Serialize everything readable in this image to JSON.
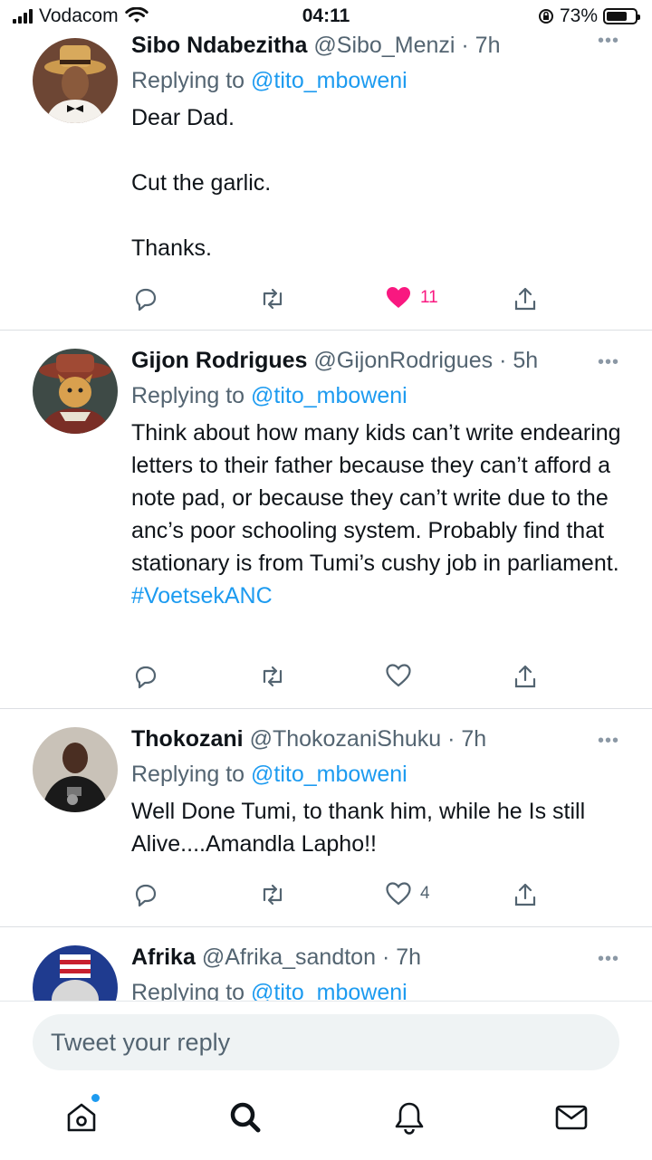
{
  "status_bar": {
    "carrier": "Vodacom",
    "time": "04:11",
    "battery": "73%",
    "battery_level": 0.73
  },
  "tweets": [
    {
      "name": "Sibo Ndabezitha",
      "handle": "@Sibo_Menzi",
      "time": "· 7h",
      "replying_prefix": "Replying to ",
      "replying_handle": "@tito_mboweni",
      "text": "Dear Dad.\n\nCut the garlic.\n\nThanks.",
      "hashtag": "",
      "likes": "11",
      "liked": true
    },
    {
      "name": "Gijon Rodrigues",
      "handle": "@GijonRodrigues",
      "time": "· 5h",
      "replying_prefix": "Replying to ",
      "replying_handle": "@tito_mboweni",
      "text": "Think about how many kids can’t write endearing letters to their father because they can’t afford a note pad, or because they can’t write due to the anc’s poor schooling system. Probably find that stationary is from Tumi’s cushy job in parliament. ",
      "hashtag": "#VoetsekANC",
      "likes": "",
      "liked": false
    },
    {
      "name": "Thokozani",
      "handle": "@ThokozaniShuku",
      "time": "· 7h",
      "replying_prefix": "Replying to ",
      "replying_handle": "@tito_mboweni",
      "text": "Well Done Tumi, to thank him, while he Is still Alive....Amandla  Lapho!!",
      "hashtag": "",
      "likes": "4",
      "liked": false
    },
    {
      "name": "Afrika",
      "handle": "@Afrika_sandton",
      "time": "· 7h",
      "replying_prefix": "Replying to ",
      "replying_handle": "@tito_mboweni",
      "text": "",
      "hashtag": "",
      "likes": "",
      "liked": false
    }
  ],
  "reply": {
    "placeholder": "Tweet your reply"
  },
  "tabs": [
    "home-icon",
    "search-icon",
    "notifications-icon",
    "messages-icon"
  ],
  "colors": {
    "accent": "#1d9bf0",
    "like": "#f91880",
    "muted": "#536471"
  }
}
